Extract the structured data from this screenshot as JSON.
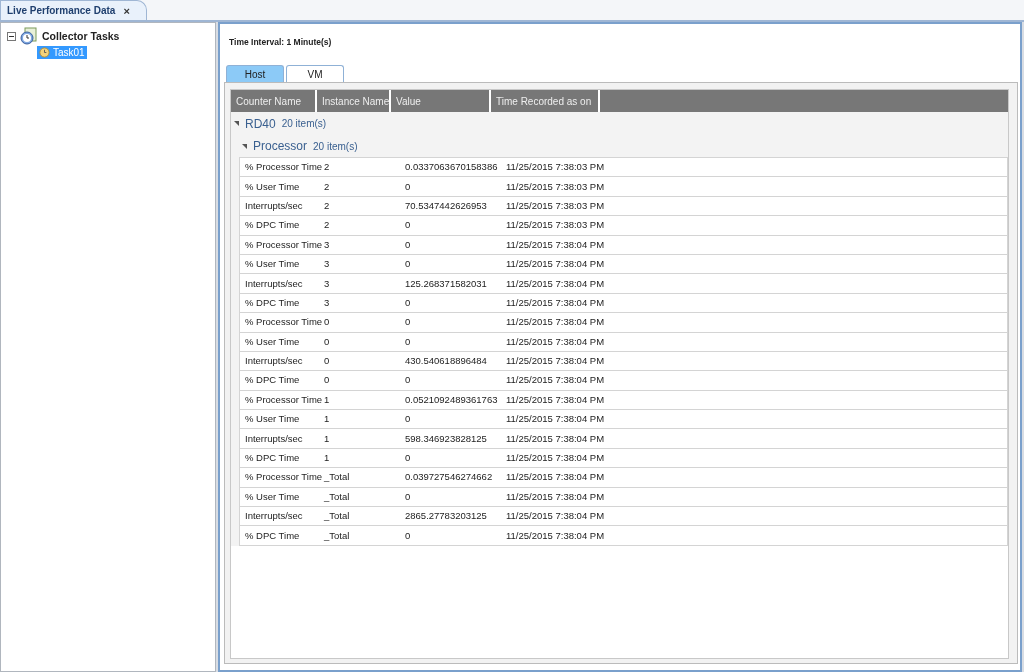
{
  "document_tab": {
    "title": "Live Performance Data",
    "close": "×"
  },
  "tree": {
    "label": "Collector Tasks",
    "expanded": true,
    "children": [
      {
        "label": "Task01",
        "selected": true
      }
    ]
  },
  "time_interval": "Time Interval: 1 Minute(s)",
  "tabs": [
    {
      "label": "Host",
      "selected": true
    },
    {
      "label": "VM",
      "selected": false
    }
  ],
  "table": {
    "columns": [
      "Counter Name",
      "Instance Name",
      "Value",
      "Time Recorded as on"
    ],
    "group": {
      "name": "RD40",
      "count": "20 item(s)",
      "expanded": true,
      "subgroup": {
        "name": "Processor",
        "count": "20 item(s)",
        "expanded": true
      }
    },
    "rows": [
      [
        "% Processor Time",
        "2",
        "0.0337063670158386",
        "11/25/2015 7:38:03 PM"
      ],
      [
        "% User Time",
        "2",
        "0",
        "11/25/2015 7:38:03 PM"
      ],
      [
        "Interrupts/sec",
        "2",
        "70.5347442626953",
        "11/25/2015 7:38:03 PM"
      ],
      [
        "% DPC Time",
        "2",
        "0",
        "11/25/2015 7:38:03 PM"
      ],
      [
        "% Processor Time",
        "3",
        "0",
        "11/25/2015 7:38:04 PM"
      ],
      [
        "% User Time",
        "3",
        "0",
        "11/25/2015 7:38:04 PM"
      ],
      [
        "Interrupts/sec",
        "3",
        "125.268371582031",
        "11/25/2015 7:38:04 PM"
      ],
      [
        "% DPC Time",
        "3",
        "0",
        "11/25/2015 7:38:04 PM"
      ],
      [
        "% Processor Time",
        "0",
        "0",
        "11/25/2015 7:38:04 PM"
      ],
      [
        "% User Time",
        "0",
        "0",
        "11/25/2015 7:38:04 PM"
      ],
      [
        "Interrupts/sec",
        "0",
        "430.540618896484",
        "11/25/2015 7:38:04 PM"
      ],
      [
        "% DPC Time",
        "0",
        "0",
        "11/25/2015 7:38:04 PM"
      ],
      [
        "% Processor Time",
        "1",
        "0.0521092489361763",
        "11/25/2015 7:38:04 PM"
      ],
      [
        "% User Time",
        "1",
        "0",
        "11/25/2015 7:38:04 PM"
      ],
      [
        "Interrupts/sec",
        "1",
        "598.346923828125",
        "11/25/2015 7:38:04 PM"
      ],
      [
        "% DPC Time",
        "1",
        "0",
        "11/25/2015 7:38:04 PM"
      ],
      [
        "% Processor Time",
        "_Total",
        "0.039727546274662",
        "11/25/2015 7:38:04 PM"
      ],
      [
        "% User Time",
        "_Total",
        "0",
        "11/25/2015 7:38:04 PM"
      ],
      [
        "Interrupts/sec",
        "_Total",
        "2865.27783203125",
        "11/25/2015 7:38:04 PM"
      ],
      [
        "% DPC Time",
        "_Total",
        "0",
        "11/25/2015 7:38:04 PM"
      ]
    ]
  }
}
